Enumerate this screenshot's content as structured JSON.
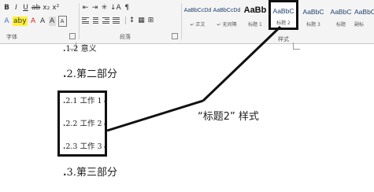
{
  "ribbon": {
    "font_tools": [
      "ab",
      "x₂",
      "x²",
      "A",
      "A",
      "A",
      "A"
    ],
    "para_tools": [
      "≡",
      "≡",
      "≡",
      "≡",
      "↕",
      "▦"
    ],
    "group_font": "字体",
    "group_paragraph": "段落",
    "group_styles": "样式",
    "styles": [
      {
        "sample": "AaBbCcDd",
        "name": "↵ 正文"
      },
      {
        "sample": "AaBbCcDd",
        "name": "↵ 无间隔"
      },
      {
        "sample": "AaBb",
        "name": "标题 1"
      },
      {
        "sample": "AaBbC",
        "name": "标题 2"
      },
      {
        "sample": "AaBbC",
        "name": "标题 3"
      },
      {
        "sample": "AaBbC",
        "name": "标题"
      },
      {
        "sample": "AaBbC",
        "name": "副标"
      }
    ],
    "selected_style_index": 3
  },
  "document": {
    "lines": [
      {
        "num": "1.2",
        "text": "意义",
        "level": 3
      },
      {
        "num": "2.",
        "text": "第二部分",
        "level": 2
      },
      {
        "num": "2.1",
        "text": "工作 1",
        "level": 3
      },
      {
        "num": "2.2",
        "text": "工作 2",
        "level": 3
      },
      {
        "num": "2.3",
        "text": "工作 3",
        "level": 3
      },
      {
        "num": "3.",
        "text": "第三部分",
        "level": 2
      }
    ],
    "callout_text": "“标题2”  样式"
  },
  "colors": {
    "ribbon_bg": "#f4f4f4",
    "style_text": "#1f3f6f",
    "highlight": "#ffef3a",
    "font_color_red": "#d22222",
    "annotation": "#111111"
  }
}
